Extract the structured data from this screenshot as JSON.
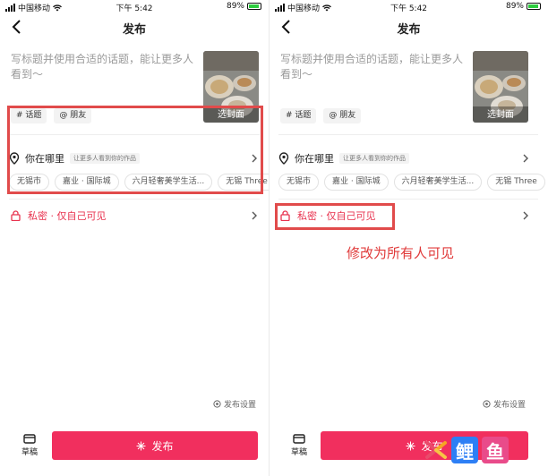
{
  "status_bar": {
    "carrier": "中国移动",
    "time": "下午 5:42",
    "battery": "89%"
  },
  "nav": {
    "title": "发布"
  },
  "caption": {
    "placeholder": "写标题并使用合适的话题，能让更多人看到～"
  },
  "cover": {
    "label": "选封面"
  },
  "chips": {
    "topic": "# 话题",
    "friend": "@ 朋友"
  },
  "location": {
    "label": "你在哪里",
    "hint": "让更多人看到你的作品"
  },
  "places": [
    "无锡市",
    "嘉业 · 国际城",
    "六月轻奢美学生活...",
    "无锡 Three"
  ],
  "privacy": {
    "label": "私密 · 仅自己可见"
  },
  "annotation": {
    "text": "修改为所有人可见"
  },
  "footer": {
    "settings": "发布设置",
    "drafts": "草稿",
    "publish": "发布"
  },
  "watermark": {
    "glyph_1": "鲤",
    "glyph_2": "鱼"
  },
  "colors": {
    "accent": "#f12f5e",
    "privacy": "#e8334f",
    "highlight": "#e14b4b"
  },
  "icons": [
    "back-icon",
    "location-pin-icon",
    "chevron-right-icon",
    "lock-icon",
    "settings-icon",
    "drafts-icon",
    "sparkle-icon"
  ]
}
